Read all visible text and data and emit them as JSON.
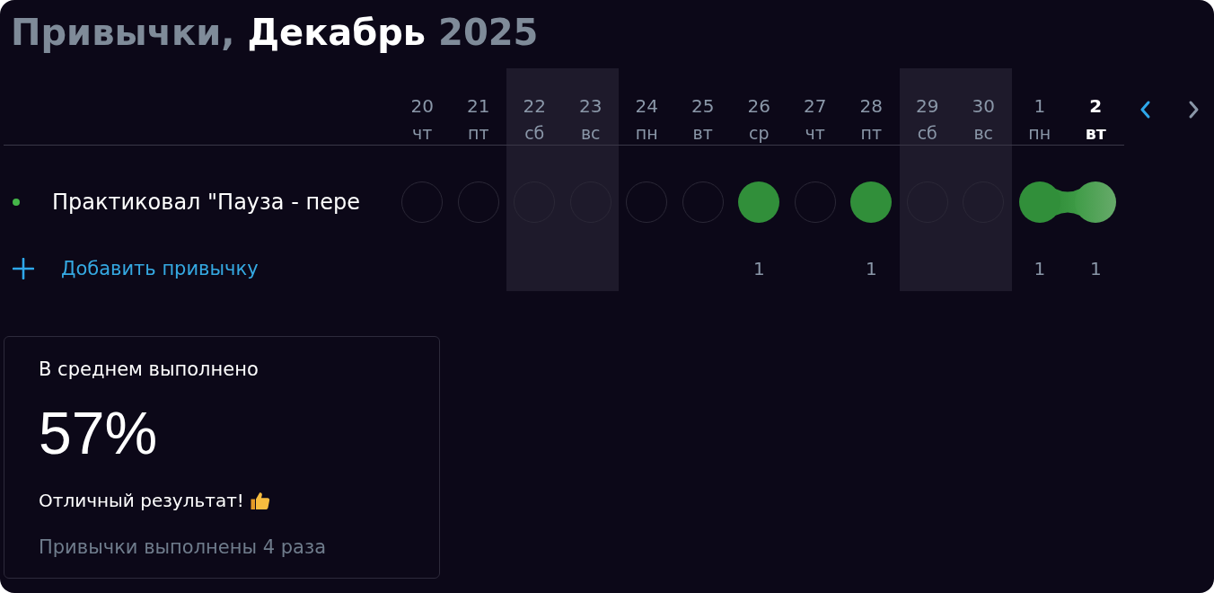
{
  "title": {
    "section": "Привычки,",
    "month": "Декабрь",
    "year": "2025"
  },
  "days": [
    {
      "day": "20",
      "weekday": "чт",
      "weekend": false,
      "today": false
    },
    {
      "day": "21",
      "weekday": "пт",
      "weekend": false,
      "today": false
    },
    {
      "day": "22",
      "weekday": "сб",
      "weekend": true,
      "today": false
    },
    {
      "day": "23",
      "weekday": "вс",
      "weekend": true,
      "today": false
    },
    {
      "day": "24",
      "weekday": "пн",
      "weekend": false,
      "today": false
    },
    {
      "day": "25",
      "weekday": "вт",
      "weekend": false,
      "today": false
    },
    {
      "day": "26",
      "weekday": "ср",
      "weekend": false,
      "today": false,
      "count": "1"
    },
    {
      "day": "27",
      "weekday": "чт",
      "weekend": false,
      "today": false
    },
    {
      "day": "28",
      "weekday": "пт",
      "weekend": false,
      "today": false,
      "count": "1"
    },
    {
      "day": "29",
      "weekday": "сб",
      "weekend": true,
      "today": false
    },
    {
      "day": "30",
      "weekday": "вс",
      "weekend": true,
      "today": false
    },
    {
      "day": "1",
      "weekday": "пн",
      "weekend": false,
      "today": false,
      "count": "1"
    },
    {
      "day": "2",
      "weekday": "вт",
      "weekend": false,
      "today": true,
      "count": "1"
    }
  ],
  "nav": [
    {
      "kind": "prev",
      "disabled": false
    },
    {
      "kind": "next",
      "disabled": true
    }
  ],
  "habits": [
    {
      "name": "Практиковал \"Пауза - пере",
      "color": "#45b649",
      "checks": [
        {
          "done": false
        },
        {
          "done": false
        },
        {
          "done": false
        },
        {
          "done": false
        },
        {
          "done": false
        },
        {
          "done": false
        },
        {
          "done": true
        },
        {
          "done": false
        },
        {
          "done": true
        },
        {
          "done": false
        },
        {
          "done": false
        },
        {
          "done": true
        },
        {
          "done": true
        }
      ]
    }
  ],
  "add_habit": {
    "label": "Добавить привычку"
  },
  "stats": {
    "title": "В среднем выполнено",
    "value": "57%",
    "message": "Отличный результат!",
    "summary": "Привычки выполнены 4 раза"
  }
}
